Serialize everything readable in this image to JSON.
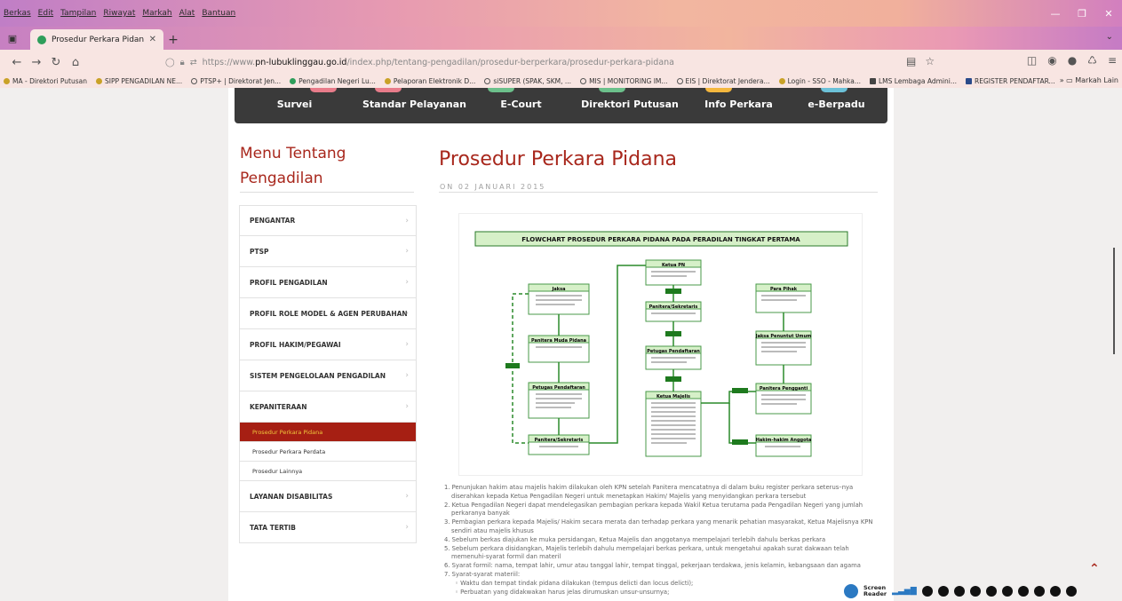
{
  "browser": {
    "menu": [
      "Berkas",
      "Edit",
      "Tampilan",
      "Riwayat",
      "Markah",
      "Alat",
      "Bantuan"
    ],
    "tab_title": "Prosedur Perkara Pidana",
    "url_prefix": "https://www.",
    "url_host": "pn-lubuklinggau.go.id",
    "url_path": "/index.php/tentang-pengadilan/prosedur-berperkara/prosedur-perkara-pidana",
    "bookmarks": [
      "MA - Direktori Putusan",
      "SIPP PENGADILAN NE...",
      "PTSP+ | Direktorat Jen...",
      "Pengadilan Negeri Lu...",
      "Pelaporan Elektronik D...",
      "siSUPER (SPAK, SKM, ...",
      "MIS | MONITORING IM...",
      "EIS | Direktorat Jendera...",
      "Login - SSO - Mahka...",
      "LMS Lembaga Admini...",
      "REGISTER PENDAFTAR..."
    ],
    "bookmarks_other": "Markah Lain"
  },
  "topnav": {
    "items": [
      "Survei",
      "Standar Pelayanan",
      "E-Court",
      "Direktori Putusan",
      "Info Perkara",
      "e-Berpadu"
    ],
    "accent_colors": [
      "#e87c8a",
      "#e87c8a",
      "#6cc08b",
      "#6cc08b",
      "#f4b73e",
      "#6cc1d8"
    ]
  },
  "sidebar": {
    "title": "Menu Tentang Pengadilan",
    "items": [
      {
        "label": "PENGANTAR"
      },
      {
        "label": "PTSP"
      },
      {
        "label": "PROFIL PENGADILAN"
      },
      {
        "label": "PROFIL ROLE MODEL & AGEN PERUBAHAN"
      },
      {
        "label": "PROFIL HAKIM/PEGAWAI"
      },
      {
        "label": "SISTEM PENGELOLAAN PENGADILAN"
      },
      {
        "label": "KEPANITERAAN"
      }
    ],
    "subitems": [
      {
        "label": "Prosedur Perkara Pidana",
        "active": true
      },
      {
        "label": "Prosedur Perkara Perdata",
        "active": false
      },
      {
        "label": "Prosedur Lainnya",
        "active": false
      }
    ],
    "items_after": [
      {
        "label": "LAYANAN DISABILITAS"
      },
      {
        "label": "TATA TERTIB"
      }
    ]
  },
  "article": {
    "title": "Prosedur Perkara Pidana",
    "date": "ON 02 JANUARI 2015",
    "flowchart_title": "FLOWCHART PROSEDUR PERKARA PIDANA PADA PERADILAN TINGKAT PERTAMA",
    "flowchart_nodes": [
      "Jaksa",
      "Panitera Muda Pidana",
      "Petugas Pendaftaran",
      "Panitera/Sekretaris",
      "Ketua PN",
      "Panitera/Sekretaris",
      "Petugas Pendaftaran",
      "Ketua Majelis",
      "Para Pihak",
      "Jaksa Penuntut Umum",
      "Panitera Pengganti",
      "Hakim-hakim Anggota"
    ],
    "steps": [
      "1. Penunjukan hakim atau majelis hakim dilakukan oleh KPN setelah Panitera mencatatnya di dalam buku register perkara seterus–nya diserahkan kepada Ketua Pengadilan Negeri untuk menetapkan Hakim/ Majelis yang menyidangkan perkara tersebut",
      "2. Ketua Pengadilan Negeri dapat mendelegasikan pembagian perkara kepada Wakil Ketua terutama pada Pengadilan Negeri yang jumlah perkaranya banyak",
      "3. Pembagian perkara kepada Majelis/ Hakim secara merata dan terhadap perkara yang menarik pehatian masyarakat, Ketua Majelisnya KPN sendiri atau majelis khusus",
      "4. Sebelum berkas diajukan ke muka persidangan, Ketua Majelis dan anggotanya mempelajari terlebih dahulu berkas perkara",
      "5. Sebelum perkara disidangkan, Majelis terlebih dahulu mempelajari berkas perkara, untuk mengetahui apakah surat dakwaan telah memenuhi-syarat formil dan materil",
      "6. Syarat formil: nama, tempat lahir, umur atau tanggal lahir, tempat tinggal, pekerjaan terdakwa, jenis kelamin, kebangsaan dan agama",
      "7. Syarat-syarat materiil:"
    ],
    "substeps": [
      "◦ Waktu dan tempat tindak pidana dilakukan (tempus delicti dan locus delicti);",
      "◦ Perbuatan yang didakwakan harus jelas dirumuskan unsur-unsurnya;"
    ]
  },
  "reader": {
    "label_line1": "Screen",
    "label_line2": "Reader"
  }
}
